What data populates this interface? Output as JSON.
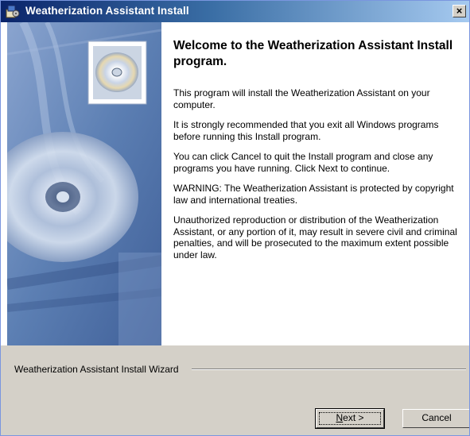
{
  "window": {
    "title": "Weatherization Assistant Install",
    "close_glyph": "×"
  },
  "main": {
    "heading": "Welcome to the Weatherization Assistant Install program.",
    "paragraphs": [
      "This program will install the Weatherization Assistant on your computer.",
      "It is strongly recommended that you exit all Windows programs before running this Install program.",
      "You can click Cancel to quit the Install program and close any programs you have running.  Click Next to continue.",
      "WARNING: The Weatherization Assistant is protected by copyright law and international treaties.",
      "Unauthorized reproduction or distribution of the Weatherization Assistant, or any portion of it, may result in severe civil and criminal penalties, and will be prosecuted to the maximum extent possible under law."
    ]
  },
  "footer": {
    "wizard_label": "Weatherization Assistant Install Wizard",
    "next_mnemonic": "N",
    "next_rest": "ext >",
    "cancel_label": "Cancel"
  },
  "icons": [
    "installer-app-icon",
    "close-icon",
    "cd-disc-icon"
  ],
  "colors": {
    "title_bar": "#0a246a",
    "dialog_face": "#d4d0c8",
    "art_blue": "#5c7fb3"
  }
}
